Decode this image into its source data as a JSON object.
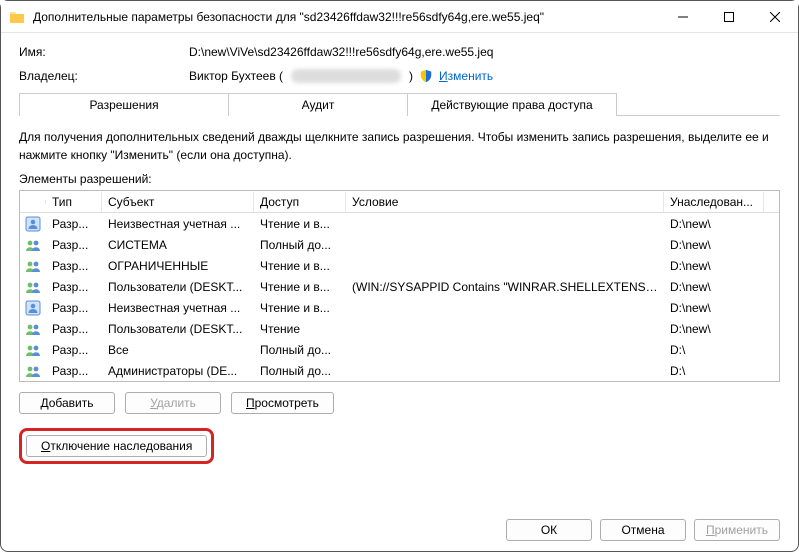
{
  "titlebar": {
    "title": "Дополнительные параметры безопасности  для \"sd23426ffdaw32!!!re56sdfy64g,ere.we55.jeq\""
  },
  "info": {
    "name_label": "Имя:",
    "name_value": "D:\\new\\ViVe\\sd23426ffdaw32!!!re56sdfy64g,ere.we55.jeq",
    "owner_label": "Владелец:",
    "owner_value": "Виктор Бухтеев (",
    "owner_value_close": ")",
    "change_link": "Изменить"
  },
  "tabs": {
    "permissions": "Разрешения",
    "audit": "Аудит",
    "effective": "Действующие права доступа"
  },
  "description": "Для получения дополнительных сведений дважды щелкните запись разрешения. Чтобы изменить запись разрешения, выделите ее и нажмите кнопку \"Изменить\" (если она доступна).",
  "subheading": "Элементы разрешений:",
  "columns": {
    "type": "Тип",
    "subject": "Субъект",
    "access": "Доступ",
    "condition": "Условие",
    "inherited": "Унаследован..."
  },
  "rows": [
    {
      "icon": "user",
      "type": "Разр...",
      "subject": "Неизвестная учетная ...",
      "access": "Чтение и в...",
      "condition": "",
      "inherited": "D:\\new\\"
    },
    {
      "icon": "group",
      "type": "Разр...",
      "subject": "СИСТЕМА",
      "access": "Полный до...",
      "condition": "",
      "inherited": "D:\\new\\"
    },
    {
      "icon": "group",
      "type": "Разр...",
      "subject": "ОГРАНИЧЕННЫЕ",
      "access": "Чтение и в...",
      "condition": "",
      "inherited": "D:\\new\\"
    },
    {
      "icon": "group",
      "type": "Разр...",
      "subject": "Пользователи (DESKT...",
      "access": "Чтение и в...",
      "condition": "(WIN://SYSAPPID Contains \"WINRAR.SHELLEXTENSION_...",
      "inherited": "D:\\new\\"
    },
    {
      "icon": "user",
      "type": "Разр...",
      "subject": "Неизвестная учетная ...",
      "access": "Чтение и в...",
      "condition": "",
      "inherited": "D:\\new\\"
    },
    {
      "icon": "group",
      "type": "Разр...",
      "subject": "Пользователи (DESKT...",
      "access": "Чтение",
      "condition": "",
      "inherited": "D:\\new\\"
    },
    {
      "icon": "group",
      "type": "Разр...",
      "subject": "Все",
      "access": "Полный до...",
      "condition": "",
      "inherited": "D:\\"
    },
    {
      "icon": "group",
      "type": "Разр...",
      "subject": "Администраторы (DE...",
      "access": "Полный до...",
      "condition": "",
      "inherited": "D:\\"
    }
  ],
  "buttons": {
    "add": "Добавить",
    "remove": "Удалить",
    "view": "Просмотреть",
    "disable_inheritance": "Отключение наследования",
    "ok": "ОК",
    "cancel": "Отмена",
    "apply": "Применить"
  }
}
